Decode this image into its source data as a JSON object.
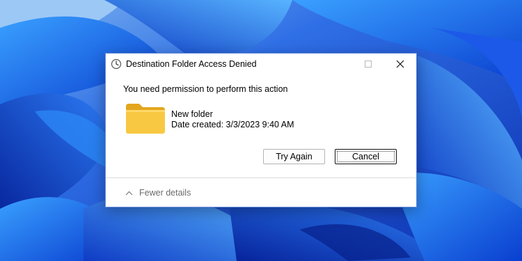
{
  "dialog": {
    "title": "Destination Folder Access Denied",
    "message": "You need permission to perform this action",
    "item": {
      "name": "New folder",
      "date_created": "Date created: 3/3/2023 9:40 AM",
      "icon": "folder-icon"
    },
    "buttons": {
      "try_again": "Try Again",
      "cancel": "Cancel"
    },
    "details_toggle": "Fewer details",
    "title_icon": "clock-icon"
  },
  "colors": {
    "wallpaper_blue": "#1a4fd6",
    "folder_yellow": "#f8c843"
  }
}
